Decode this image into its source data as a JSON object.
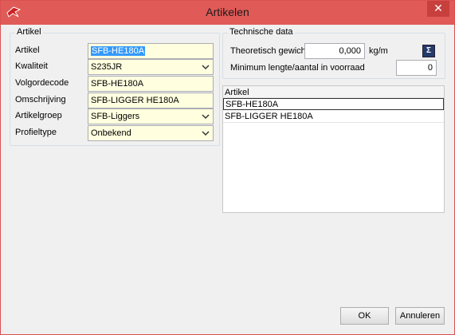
{
  "window": {
    "title": "Artikelen",
    "close_glyph": "✕"
  },
  "artikel_group": {
    "title": "Artikel",
    "fields": [
      {
        "label": "Artikel",
        "value": "SFB-HE180A"
      },
      {
        "label": "Kwaliteit",
        "value": "S235JR"
      },
      {
        "label": "Volgordecode",
        "value": "SFB-HE180A"
      },
      {
        "label": "Omschrijving",
        "value": "SFB-LIGGER HE180A"
      },
      {
        "label": "Artikelgroep",
        "value": "SFB-Liggers"
      },
      {
        "label": "Profieltype",
        "value": "Onbekend"
      }
    ]
  },
  "technische_group": {
    "title": "Technische data",
    "gewicht_label": "Theoretisch gewicht",
    "gewicht_value": "0,000",
    "gewicht_unit": "kg/m",
    "calc_button_glyph": "Σ",
    "minimum_label": "Minimum lengte/aantal in voorraad",
    "minimum_value": "0"
  },
  "artikel_list": {
    "header": "Artikel",
    "rows": [
      "SFB-HE180A",
      "SFB-LIGGER HE180A"
    ]
  },
  "buttons": {
    "ok": "OK",
    "cancel": "Annuleren"
  },
  "colors": {
    "titlebar": "#e05a57",
    "close": "#c7403d",
    "highlight": "#3399ff",
    "yellow_field": "#ffffe0"
  }
}
